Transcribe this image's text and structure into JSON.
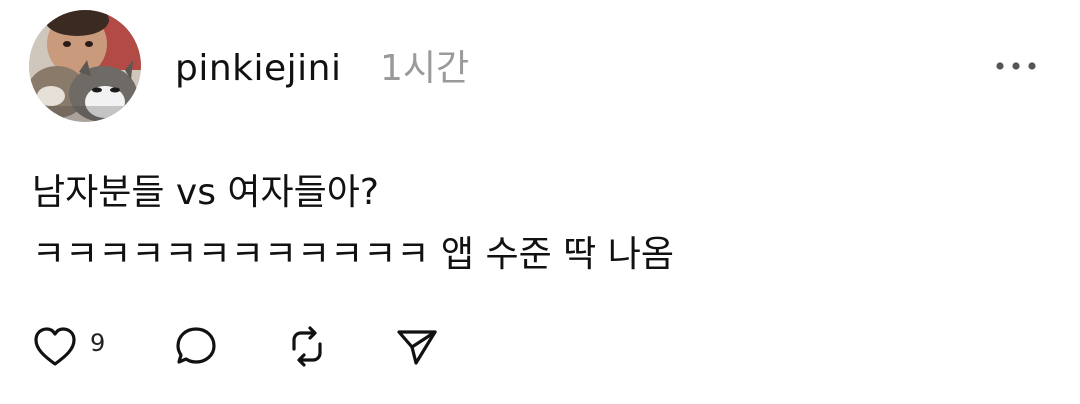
{
  "post": {
    "username": "pinkiejini",
    "timestamp": "1시간",
    "content_lines": [
      "남자분들 vs 여자들아?",
      "ㅋㅋㅋㅋㅋㅋㅋㅋㅋㅋㅋㅋ 앱 수준 딱 나옴"
    ],
    "like_count": "9"
  },
  "icons": {
    "more": "more-horizontal-icon",
    "like": "heart-icon",
    "reply": "comment-icon",
    "repost": "repost-icon",
    "share": "send-icon"
  },
  "colors": {
    "text": "#111111",
    "muted": "#9a9a9a",
    "icon": "#111111"
  }
}
